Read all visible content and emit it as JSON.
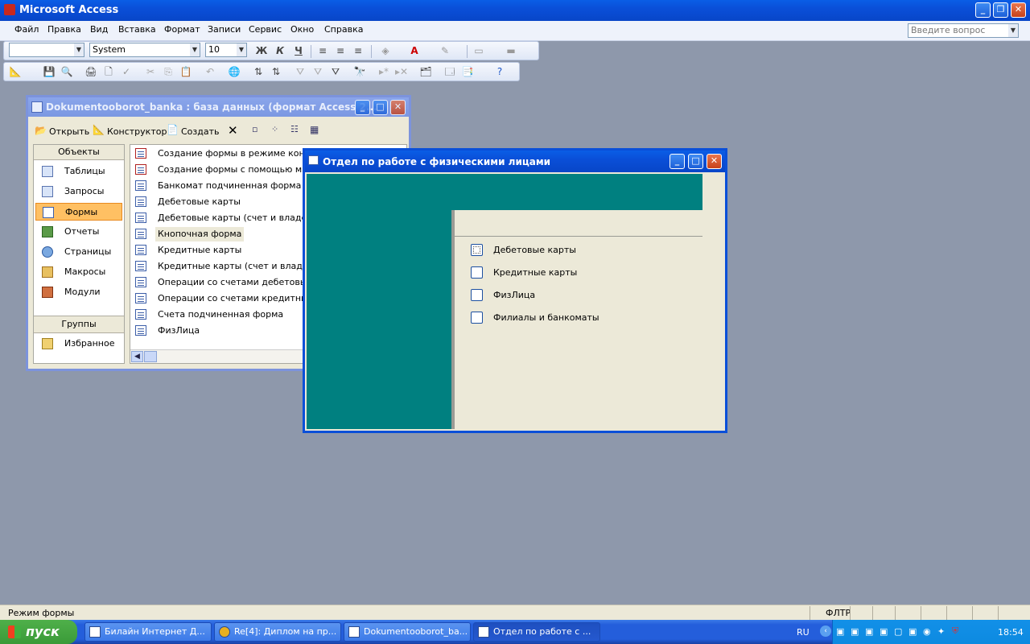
{
  "app": {
    "title": "Microsoft Access"
  },
  "menu": {
    "items": [
      "Файл",
      "Правка",
      "Вид",
      "Вставка",
      "Формат",
      "Записи",
      "Сервис",
      "Окно",
      "Справка"
    ],
    "help_placeholder": "Введите вопрос"
  },
  "format_toolbar": {
    "object_combo": "",
    "font": "System",
    "size": "10",
    "bold": "Ж",
    "italic": "К",
    "underline": "Ч"
  },
  "db_window": {
    "title": "Dokumentooborot_banka : база данных (формат Access 2...",
    "toolbar": {
      "open": "Открыть",
      "design": "Конструктор",
      "create": "Создать"
    },
    "objects_header": "Объекты",
    "objects": [
      "Таблицы",
      "Запросы",
      "Формы",
      "Отчеты",
      "Страницы",
      "Макросы",
      "Модули"
    ],
    "selected_object": "Формы",
    "groups_header": "Группы",
    "groups": [
      "Избранное"
    ],
    "forms": [
      "Создание формы в режиме констру",
      "Создание формы с помощью мастер",
      "Банкомат подчиненная форма",
      "Дебетовые карты",
      "Дебетовые карты (счет и владелец",
      "Кнопочная форма",
      "Кредитные карты",
      "Кредитные карты (счет и владелец",
      "Операции со счетами дебетовых ка",
      "Операции со счетами кредитных ка",
      "Счета подчиненная форма",
      "ФизЛица"
    ],
    "selected_form": "Кнопочная форма"
  },
  "form_window": {
    "title": "Отдел по работе с физическими лицами",
    "options": [
      "Дебетовые карты",
      "Кредитные карты",
      "ФизЛица",
      "Филиалы и банкоматы"
    ],
    "colors": {
      "teal": "#008080",
      "panel": "#ece9d8"
    }
  },
  "status": {
    "text": "Режим формы",
    "filter": "ФЛТР"
  },
  "taskbar": {
    "start": "пуск",
    "buttons": [
      "Билайн Интернет Д...",
      "Re[4]: Диплом на пр...",
      "Dokumentooborot_ba...",
      "Отдел по работе с ..."
    ],
    "active_button": 3,
    "lang": "RU",
    "clock": "18:54"
  }
}
